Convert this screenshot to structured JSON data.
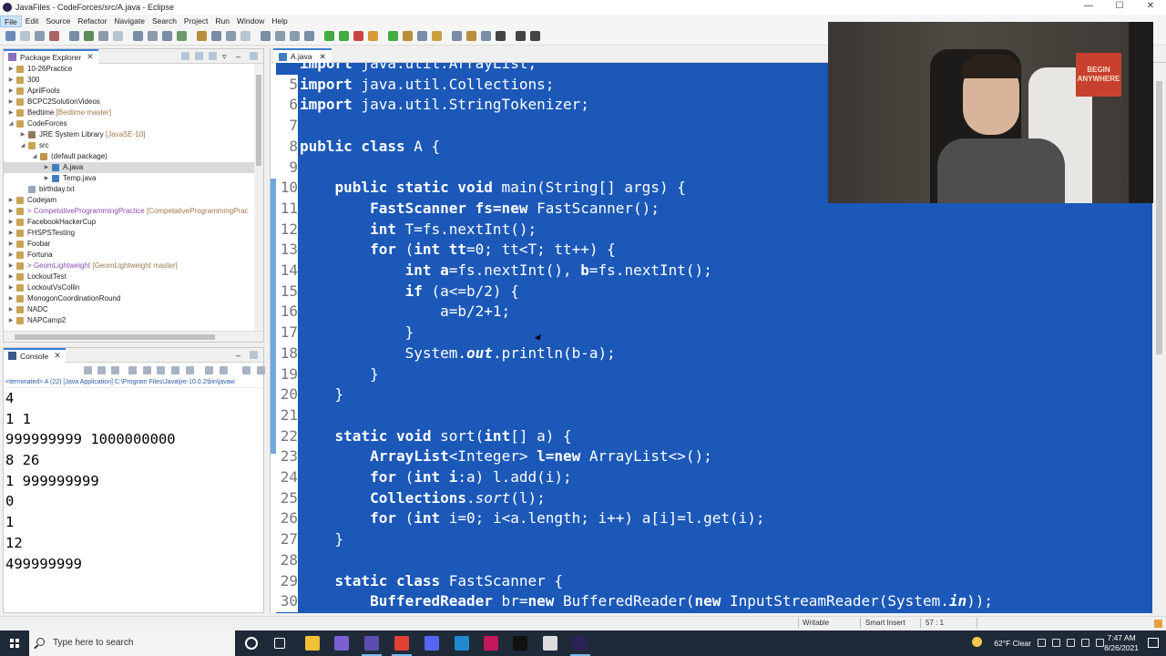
{
  "window": {
    "title": "JavaFiles - CodeForces/src/A.java - Eclipse",
    "controls": [
      "—",
      "☐",
      "✕"
    ]
  },
  "menu": [
    "File",
    "Edit",
    "Source",
    "Refactor",
    "Navigate",
    "Search",
    "Project",
    "Run",
    "Window",
    "Help"
  ],
  "package_explorer": {
    "tab_label": "Package Explorer",
    "items": [
      {
        "label": "10-26Practice",
        "sub": "",
        "depth": 0,
        "arrow": "▶",
        "icon": "folder-icon"
      },
      {
        "label": "300",
        "sub": "",
        "depth": 0,
        "arrow": "▶",
        "icon": "folder-icon"
      },
      {
        "label": "AprilFools",
        "sub": "",
        "depth": 0,
        "arrow": "▶",
        "icon": "folder-icon"
      },
      {
        "label": "BCPC2SolutionVideos",
        "sub": "",
        "depth": 0,
        "arrow": "▶",
        "icon": "folder-icon"
      },
      {
        "label": "Bedtime",
        "sub": "[Bedtime master]",
        "depth": 0,
        "arrow": "▶",
        "icon": "folder-icon"
      },
      {
        "label": "CodeForces",
        "sub": "",
        "depth": 0,
        "arrow": "◢",
        "icon": "folder-icon"
      },
      {
        "label": "JRE System Library",
        "sub": "[JavaSE-10]",
        "depth": 1,
        "arrow": "▶",
        "icon": "library-icon"
      },
      {
        "label": "src",
        "sub": "",
        "depth": 1,
        "arrow": "◢",
        "icon": "package-folder-icon"
      },
      {
        "label": "(default package)",
        "sub": "",
        "depth": 2,
        "arrow": "◢",
        "icon": "package-icon"
      },
      {
        "label": "A.java",
        "sub": "",
        "depth": 3,
        "arrow": "▶",
        "icon": "java-file-icon",
        "selected": true
      },
      {
        "label": "Temp.java",
        "sub": "",
        "depth": 3,
        "arrow": "▶",
        "icon": "java-file-icon"
      },
      {
        "label": "birthday.txt",
        "sub": "",
        "depth": 1,
        "arrow": "",
        "icon": "text-file-icon"
      },
      {
        "label": "Codejam",
        "sub": "",
        "depth": 0,
        "arrow": "▶",
        "icon": "folder-icon"
      },
      {
        "label": "> CompetativeProgrammingPractice",
        "sub": "[CompetativeProgrammingPrac",
        "depth": 0,
        "arrow": "▶",
        "icon": "folder-icon",
        "git": true
      },
      {
        "label": "FacebookHackerCup",
        "sub": "",
        "depth": 0,
        "arrow": "▶",
        "icon": "folder-icon"
      },
      {
        "label": "FHSPSTesting",
        "sub": "",
        "depth": 0,
        "arrow": "▶",
        "icon": "folder-icon"
      },
      {
        "label": "Foobar",
        "sub": "",
        "depth": 0,
        "arrow": "▶",
        "icon": "folder-icon"
      },
      {
        "label": "Fortuna",
        "sub": "",
        "depth": 0,
        "arrow": "▶",
        "icon": "folder-icon"
      },
      {
        "label": "> GeomLightweight",
        "sub": "[GeomLightweight master]",
        "depth": 0,
        "arrow": "▶",
        "icon": "folder-icon",
        "git": true
      },
      {
        "label": "LockoutTest",
        "sub": "",
        "depth": 0,
        "arrow": "▶",
        "icon": "folder-icon"
      },
      {
        "label": "LockoutVsCollin",
        "sub": "",
        "depth": 0,
        "arrow": "▶",
        "icon": "folder-icon"
      },
      {
        "label": "MonogonCoordinationRound",
        "sub": "",
        "depth": 0,
        "arrow": "▶",
        "icon": "folder-icon"
      },
      {
        "label": "NADC",
        "sub": "",
        "depth": 0,
        "arrow": "▶",
        "icon": "folder-icon"
      },
      {
        "label": "NAPCamp2",
        "sub": "",
        "depth": 0,
        "arrow": "▶",
        "icon": "folder-icon"
      }
    ]
  },
  "console": {
    "tab_label": "Console",
    "terminated": "<terminated> A (22) [Java Application] C:\\Program Files\\Java\\jre-10.0.2\\bin\\javaw",
    "output": [
      "4",
      "1 1",
      "999999999 1000000000",
      "8 26",
      "1 999999999",
      "0",
      "1",
      "12",
      "499999999"
    ]
  },
  "editor": {
    "tab_label": "A.java",
    "lines": [
      {
        "n": "",
        "html": "<b>import</b> java.util.ArrayList;"
      },
      {
        "n": "5",
        "html": "<b>import</b> java.util.Collections;"
      },
      {
        "n": "6",
        "html": "<b>import</b> java.util.StringTokenizer;"
      },
      {
        "n": "7",
        "html": ""
      },
      {
        "n": "8",
        "html": "<b>public class</b> A {"
      },
      {
        "n": "9",
        "html": ""
      },
      {
        "n": "10",
        "html": "    <b>public static void</b> main(String[] args) {"
      },
      {
        "n": "11",
        "html": "        <b>FastScanner fs=new</b> FastScanner();"
      },
      {
        "n": "12",
        "html": "        <b>int</b> T=fs.nextInt();"
      },
      {
        "n": "13",
        "html": "        <b>for</b> (<b>int tt</b>=0; tt&lt;T; tt++) {"
      },
      {
        "n": "14",
        "html": "            <b>int a</b>=fs.nextInt(), <b>b</b>=fs.nextInt();"
      },
      {
        "n": "15",
        "html": "            <b>if</b> (a&lt;=b/2) {"
      },
      {
        "n": "16",
        "html": "                a=b/2+1;"
      },
      {
        "n": "17",
        "html": "            }"
      },
      {
        "n": "18",
        "html": "            System.<b><i>out</i></b>.println(b-a);"
      },
      {
        "n": "19",
        "html": "        }"
      },
      {
        "n": "20",
        "html": "    }"
      },
      {
        "n": "21",
        "html": ""
      },
      {
        "n": "22",
        "html": "    <b>static void</b> sort(<b>int</b>[] a) {"
      },
      {
        "n": "23",
        "html": "        <b>ArrayList</b>&lt;Integer&gt; <b>l=new</b> ArrayList&lt;&gt;();"
      },
      {
        "n": "24",
        "html": "        <b>for</b> (<b>int i</b>:a) l.add(i);"
      },
      {
        "n": "25",
        "html": "        <b>Collections</b>.<i>sort</i>(l);"
      },
      {
        "n": "26",
        "html": "        <b>for</b> (<b>int</b> i=0; i&lt;a.length; i++) a[i]=l.get(i);"
      },
      {
        "n": "27",
        "html": "    }"
      },
      {
        "n": "28",
        "html": ""
      },
      {
        "n": "29",
        "html": "    <b>static class</b> FastScanner {"
      },
      {
        "n": "30",
        "html": "        <b>BufferedReader</b> br=<b>new</b> BufferedReader(<b>new</b> InputStreamReader(System.<b><i>in</i></b>));"
      }
    ]
  },
  "webcam": {
    "poster_text": "BEGIN ANYWHERE"
  },
  "statusbar": {
    "writable": "Writable",
    "insert_mode": "Smart Insert",
    "position": "57 : 1"
  },
  "taskbar": {
    "search_placeholder": "Type here to search",
    "weather": "62°F  Clear",
    "time": "7:47 AM",
    "date": "8/26/2021",
    "apps": [
      {
        "name": "cortana-icon",
        "color": "#ffffff"
      },
      {
        "name": "task-view-icon",
        "color": "#ffffff"
      },
      {
        "name": "file-explorer-icon",
        "color": "#f2c037"
      },
      {
        "name": "eclipse-icon",
        "color": "#7b5fd6"
      },
      {
        "name": "eclipse-icon",
        "color": "#5c4db3"
      },
      {
        "name": "chrome-icon",
        "color": "#e34133"
      },
      {
        "name": "discord-icon",
        "color": "#5865f2"
      },
      {
        "name": "vscode-icon",
        "color": "#1f8ad2"
      },
      {
        "name": "intellij-icon",
        "color": "#c1185b"
      },
      {
        "name": "terminal-icon",
        "color": "#111111"
      },
      {
        "name": "obs-icon",
        "color": "#dddddd"
      },
      {
        "name": "eclipse-running-icon",
        "color": "#2c2255"
      }
    ]
  }
}
